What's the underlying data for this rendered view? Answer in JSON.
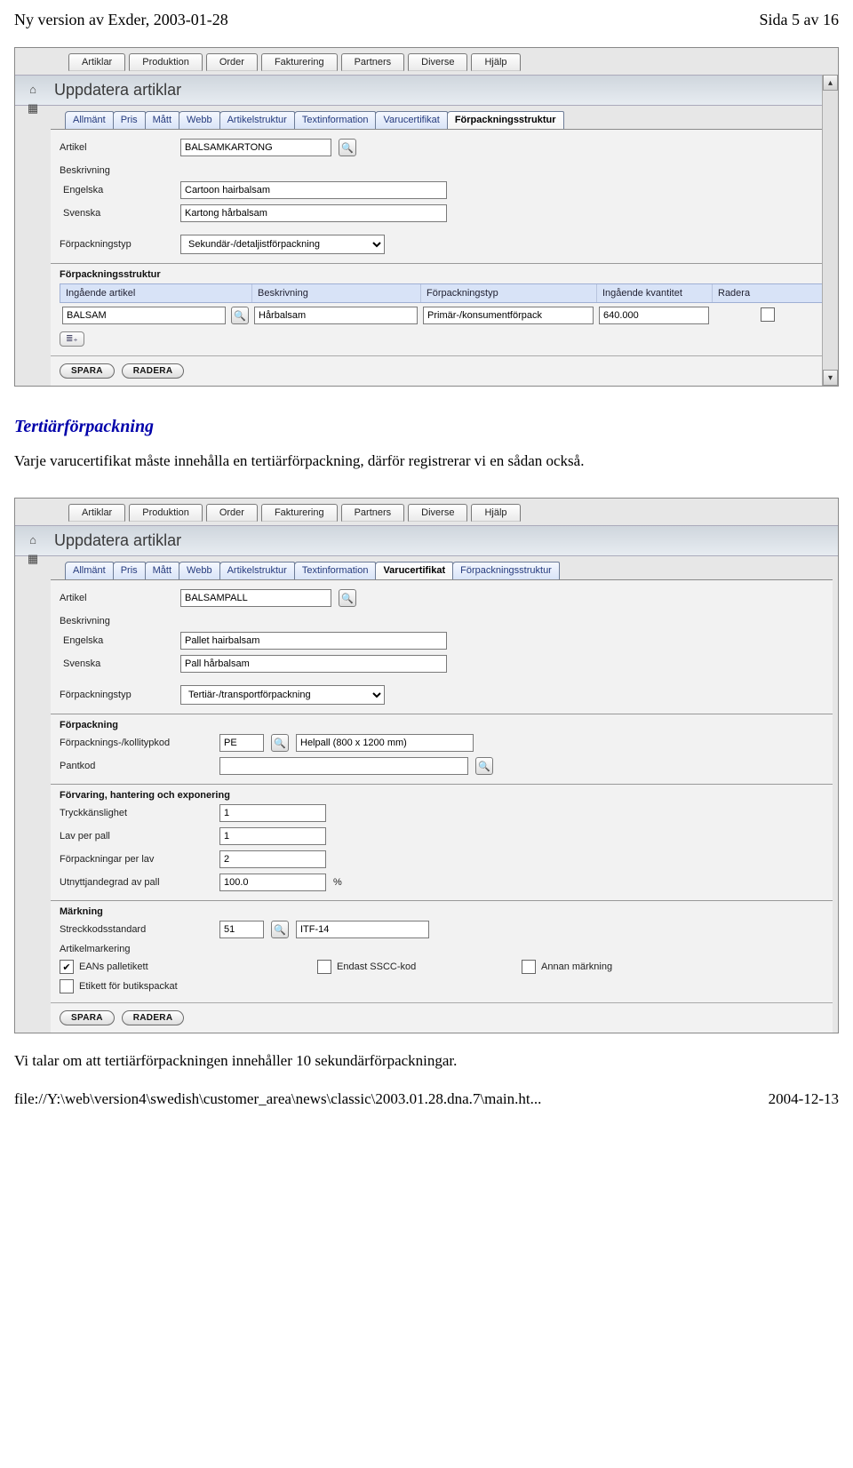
{
  "header": {
    "left": "Ny version av Exder, 2003-01-28",
    "right": "Sida 5 av 16"
  },
  "section1_title": "Tertiärförpackning",
  "section1_text": "Varje varucertifikat måste innehålla en tertiärförpackning, därför registrerar vi en sådan också.",
  "menu": [
    "Artiklar",
    "Produktion",
    "Order",
    "Fakturering",
    "Partners",
    "Diverse",
    "Hjälp"
  ],
  "app_title": "Uppdatera artiklar",
  "tabs": [
    "Allmänt",
    "Pris",
    "Mått",
    "Webb",
    "Artikelstruktur",
    "Textinformation",
    "Varucertifikat",
    "Förpackningsstruktur"
  ],
  "screen1": {
    "active_tab": 7,
    "artikel_label": "Artikel",
    "artikel_value": "BALSAMKARTONG",
    "beskrivning_label": "Beskrivning",
    "eng_label": "Engelska",
    "eng_value": "Cartoon hairbalsam",
    "sve_label": "Svenska",
    "sve_value": "Kartong hårbalsam",
    "fpktyp_label": "Förpackningstyp",
    "fpktyp_value": "Sekundär-/detaljistförpackning",
    "struct_label": "Förpackningsstruktur",
    "th": {
      "c1": "Ingående artikel",
      "c2": "Beskrivning",
      "c3": "Förpackningstyp",
      "c4": "Ingående kvantitet",
      "c5": "Radera"
    },
    "trow": {
      "artikel": "BALSAM",
      "beskr": "Hårbalsam",
      "typ": "Primär-/konsumentförpack",
      "kvant": "640.000"
    },
    "add_icon": "≣₊",
    "btn_save": "SPARA",
    "btn_delete": "RADERA"
  },
  "screen2": {
    "active_tab": 6,
    "artikel_label": "Artikel",
    "artikel_value": "BALSAMPALL",
    "beskrivning_label": "Beskrivning",
    "eng_label": "Engelska",
    "eng_value": "Pallet hairbalsam",
    "sve_label": "Svenska",
    "sve_value": "Pall hårbalsam",
    "fpktyp_label": "Förpackningstyp",
    "fpktyp_value": "Tertiär-/transportförpackning",
    "forp_label": "Förpackning",
    "kolli_label": "Förpacknings-/kollitypkod",
    "kolli_code": "PE",
    "kolli_desc": "Helpall (800 x 1200 mm)",
    "pantkod_label": "Pantkod",
    "grp2_label": "Förvaring, hantering och exponering",
    "tryck_label": "Tryckkänslighet",
    "tryck_value": "1",
    "lav_label": "Lav per pall",
    "lav_value": "1",
    "perlav_label": "Förpackningar per lav",
    "perlav_value": "2",
    "utnytt_label": "Utnyttjandegrad av pall",
    "utnytt_value": "100.0",
    "pct": "%",
    "markning_label": "Märkning",
    "streck_label": "Streckkodsstandard",
    "streck_code": "51",
    "streck_desc": "ITF-14",
    "amark_label": "Artikelmarkering",
    "cb1": "EANs palletikett",
    "cb2": "Endast SSCC-kod",
    "cb3": "Annan märkning",
    "cb4": "Etikett för butikspackat",
    "btn_save": "SPARA",
    "btn_delete": "RADERA"
  },
  "section2_text": "Vi talar om att tertiärförpackningen innehåller 10 sekundärförpackningar.",
  "footer": {
    "left": "file://Y:\\web\\version4\\swedish\\customer_area\\news\\classic\\2003.01.28.dna.7\\main.ht...",
    "right": "2004-12-13"
  },
  "icons": {
    "search": "🔍",
    "home": "⌂",
    "grid": "▦",
    "up": "▴",
    "down": "▾"
  }
}
